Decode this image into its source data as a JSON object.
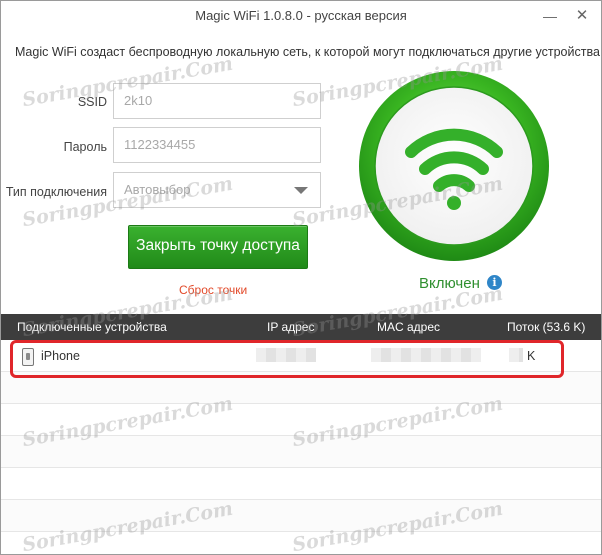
{
  "window": {
    "title": "Magic WiFi  1.0.8.0 - русская версия",
    "minimize_symbol": "—",
    "close_symbol": "✕"
  },
  "description": "Magic WiFi создаст беспроводную локальную сеть, к которой могут подключаться другие устройства.",
  "form": {
    "ssid_label": "SSID",
    "ssid_value": "2k10",
    "password_label": "Пароль",
    "password_value": "1122334455",
    "connection_type_label": "Тип подключения",
    "connection_type_value": "Автовыбор"
  },
  "actions": {
    "close_ap_label": "Закрыть точку доступа",
    "reset_label": "Сброс точки"
  },
  "status": {
    "text": "Включен",
    "info_symbol": "i"
  },
  "table": {
    "headers": {
      "devices": "Подключенные устройства",
      "ip": "IP адрес",
      "mac": "MAC адрес",
      "traffic": "Поток (53.6 K)"
    },
    "rows": [
      {
        "device": "iPhone",
        "traffic_suffix": "K"
      }
    ]
  },
  "watermark": "Soringpcrepair.Com",
  "colors": {
    "accent_green": "#2aa524",
    "header_bg": "#3d3d3d",
    "highlight_red": "#e0262a",
    "reset_red": "#e24a2a",
    "info_blue": "#2f86c8"
  }
}
